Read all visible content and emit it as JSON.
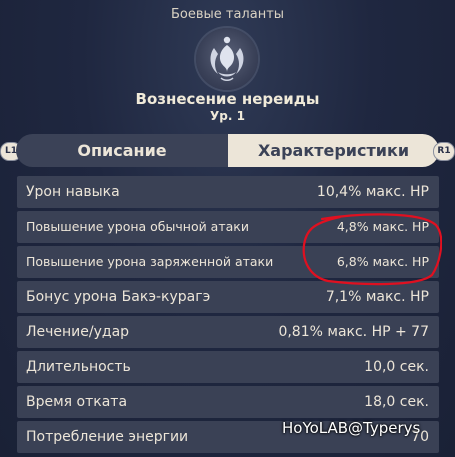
{
  "header": {
    "category": "Боевые таланты",
    "talent_name": "Вознесение нереиды",
    "level": "Ур. 1",
    "emblem_icon": "nereid-emblem-icon"
  },
  "tabs": {
    "left_shoulder": "L1",
    "right_shoulder": "R1",
    "description": "Описание",
    "attributes": "Характеристики",
    "active": "attributes"
  },
  "attributes": [
    {
      "label": "Урон навыка",
      "value": "10,4% макс. HP"
    },
    {
      "label": "Повышение урона обычной атаки",
      "value": "4,8% макс. HP"
    },
    {
      "label": "Повышение урона заряженной атаки",
      "value": "6,8% макс. HP"
    },
    {
      "label": "Бонус урона Бакэ-курагэ",
      "value": "7,1% макс. HP"
    },
    {
      "label": "Лечение/удар",
      "value": "0,81% макс. HP + 77"
    },
    {
      "label": "Длительность",
      "value": "10,0 сек."
    },
    {
      "label": "Время отката",
      "value": "18,0 сек."
    },
    {
      "label": "Потребление энергии",
      "value": "70"
    }
  ],
  "watermark": "HoYoLAB@Typerys",
  "colors": {
    "background": "#1f2740",
    "row": "#3a4155",
    "text": "#ece5d8",
    "annotation": "#e01020"
  }
}
